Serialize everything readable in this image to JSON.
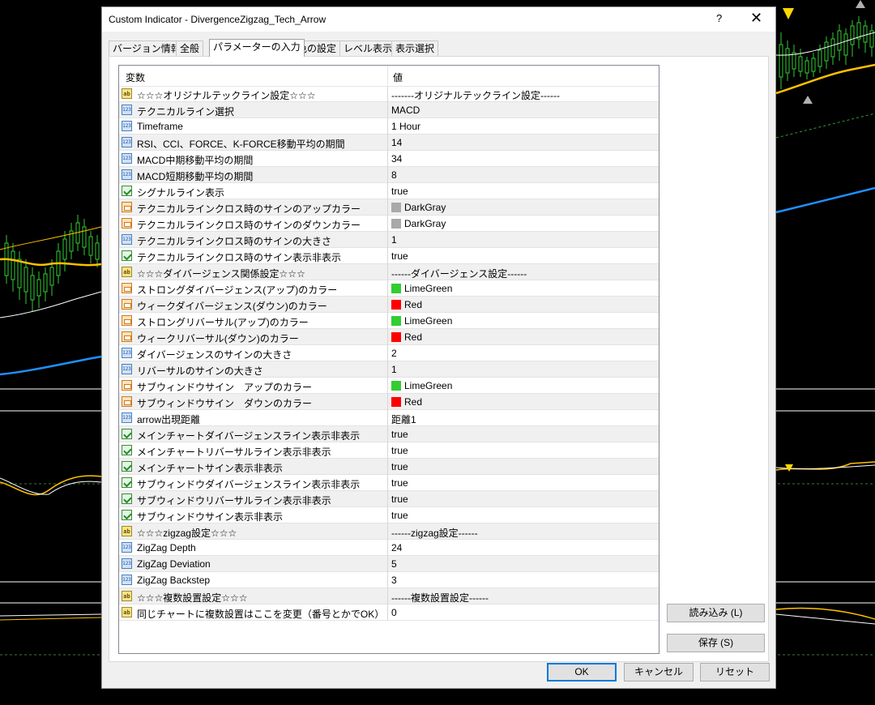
{
  "window": {
    "title": "Custom Indicator - DivergenceZigzag_Tech_Arrow",
    "help_glyph": "?",
    "close_glyph": "✕"
  },
  "tabs": [
    {
      "label": "バージョン情報",
      "active": false
    },
    {
      "label": "全般",
      "active": false
    },
    {
      "label": "パラメーターの入力",
      "active": true
    },
    {
      "label": "色の設定",
      "active": false
    },
    {
      "label": "レベル表示",
      "active": false
    },
    {
      "label": "表示選択",
      "active": false
    }
  ],
  "grid": {
    "col_variable": "変数",
    "col_value": "値",
    "rows": [
      {
        "icon": "ab",
        "name": "☆☆☆オリジナルテックライン設定☆☆☆",
        "value": "-------オリジナルテックライン設定------"
      },
      {
        "icon": "123",
        "name": "テクニカルライン選択",
        "value": "MACD"
      },
      {
        "icon": "123",
        "name": "Timeframe",
        "value": "1 Hour"
      },
      {
        "icon": "123",
        "name": "RSI、CCI、FORCE、K-FORCE移動平均の期間",
        "value": "14"
      },
      {
        "icon": "123",
        "name": "MACD中期移動平均の期間",
        "value": "34"
      },
      {
        "icon": "123",
        "name": "MACD短期移動平均の期間",
        "value": "8"
      },
      {
        "icon": "bool",
        "name": "シグナルライン表示",
        "value": "true"
      },
      {
        "icon": "color",
        "name": "テクニカルラインクロス時のサインのアップカラー",
        "value": "DarkGray",
        "swatch": "#a9a9a9"
      },
      {
        "icon": "color",
        "name": "テクニカルラインクロス時のサインのダウンカラー",
        "value": "DarkGray",
        "swatch": "#a9a9a9"
      },
      {
        "icon": "123",
        "name": "テクニカルラインクロス時のサインの大きさ",
        "value": "1"
      },
      {
        "icon": "bool",
        "name": "テクニカルラインクロス時のサイン表示非表示",
        "value": "true"
      },
      {
        "icon": "ab",
        "name": "☆☆☆ダイバージェンス関係設定☆☆☆",
        "value": "------ダイバージェンス設定------"
      },
      {
        "icon": "color",
        "name": "ストロングダイバージェンス(アップ)のカラー",
        "value": "LimeGreen",
        "swatch": "#32cd32"
      },
      {
        "icon": "color",
        "name": "ウィークダイバージェンス(ダウン)のカラー",
        "value": "Red",
        "swatch": "#ff0000"
      },
      {
        "icon": "color",
        "name": "ストロングリバーサル(アップ)のカラー",
        "value": "LimeGreen",
        "swatch": "#32cd32"
      },
      {
        "icon": "color",
        "name": "ウィークリバーサル(ダウン)のカラー",
        "value": "Red",
        "swatch": "#ff0000"
      },
      {
        "icon": "123",
        "name": "ダイバージェンスのサインの大きさ",
        "value": "2"
      },
      {
        "icon": "123",
        "name": "リバーサルのサインの大きさ",
        "value": "1"
      },
      {
        "icon": "color",
        "name": "サブウィンドウサイン　アップのカラー",
        "value": "LimeGreen",
        "swatch": "#32cd32"
      },
      {
        "icon": "color",
        "name": "サブウィンドウサイン　ダウンのカラー",
        "value": "Red",
        "swatch": "#ff0000"
      },
      {
        "icon": "123",
        "name": "arrow出現距離",
        "value": "距離1"
      },
      {
        "icon": "bool",
        "name": "メインチャートダイバージェンスライン表示非表示",
        "value": "true"
      },
      {
        "icon": "bool",
        "name": "メインチャートリバーサルライン表示非表示",
        "value": "true"
      },
      {
        "icon": "bool",
        "name": "メインチャートサイン表示非表示",
        "value": "true"
      },
      {
        "icon": "bool",
        "name": "サブウィンドウダイバージェンスライン表示非表示",
        "value": "true"
      },
      {
        "icon": "bool",
        "name": "サブウィンドウリバーサルライン表示非表示",
        "value": "true"
      },
      {
        "icon": "bool",
        "name": "サブウィンドウサイン表示非表示",
        "value": "true"
      },
      {
        "icon": "ab",
        "name": "☆☆☆zigzag設定☆☆☆",
        "value": "------zigzag設定------"
      },
      {
        "icon": "123",
        "name": "ZigZag Depth",
        "value": "24"
      },
      {
        "icon": "123",
        "name": "ZigZag Deviation",
        "value": "5"
      },
      {
        "icon": "123",
        "name": "ZigZag Backstep",
        "value": "3"
      },
      {
        "icon": "ab",
        "name": "☆☆☆複数設置設定☆☆☆",
        "value": "------複数設置設定------"
      },
      {
        "icon": "ab",
        "name": "同じチャートに複数設置はここを変更（番号とかでOK）",
        "value": "0"
      }
    ]
  },
  "buttons": {
    "load": "読み込み (L)",
    "save": "保存 (S)",
    "ok": "OK",
    "cancel": "キャンセル",
    "reset": "リセット"
  },
  "colors": {
    "accent": "#0078d7",
    "chart_bg": "#000000",
    "candle_up": "#32cd32",
    "ma_orange": "#ffc000",
    "ma_blue": "#1e90ff",
    "arrow_yellow": "#ffd700"
  }
}
